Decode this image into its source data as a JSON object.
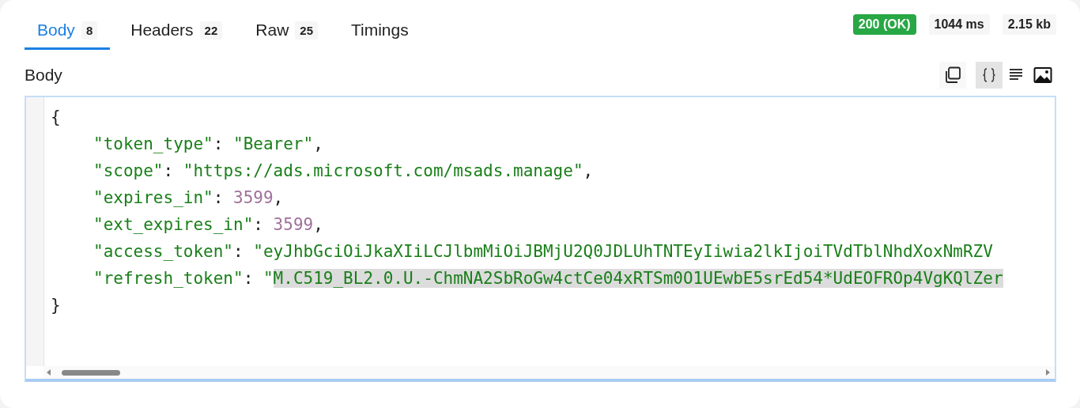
{
  "tabs": [
    {
      "label": "Body",
      "count": "8",
      "selected": true
    },
    {
      "label": "Headers",
      "count": "22",
      "selected": false
    },
    {
      "label": "Raw",
      "count": "25",
      "selected": false
    },
    {
      "label": "Timings",
      "selected": false
    }
  ],
  "status": {
    "code": "200 (OK)",
    "time": "1044 ms",
    "size": "2.15 kb"
  },
  "section_title": "Body",
  "view_modes": [
    {
      "kind": "json",
      "selected": true
    },
    {
      "kind": "text",
      "selected": false
    },
    {
      "kind": "image",
      "selected": false
    }
  ],
  "code_lines": [
    {
      "parts": [
        {
          "text": "{",
          "kind": "punct"
        }
      ]
    },
    {
      "parts": [
        {
          "text": "\"token_type\"",
          "kind": "key"
        },
        {
          "text": ": ",
          "kind": "punct"
        },
        {
          "text": "\"Bearer\"",
          "kind": "string"
        },
        {
          "text": ",",
          "kind": "punct"
        }
      ]
    },
    {
      "parts": [
        {
          "text": "\"scope\"",
          "kind": "key"
        },
        {
          "text": ": ",
          "kind": "punct"
        },
        {
          "text": "\"https://ads.microsoft.com/msads.manage\"",
          "kind": "string"
        },
        {
          "text": ",",
          "kind": "punct"
        }
      ]
    },
    {
      "parts": [
        {
          "text": "\"expires_in\"",
          "kind": "key"
        },
        {
          "text": ": ",
          "kind": "punct"
        },
        {
          "text": "3599",
          "kind": "number"
        },
        {
          "text": ",",
          "kind": "punct"
        }
      ]
    },
    {
      "parts": [
        {
          "text": "\"ext_expires_in\"",
          "kind": "key"
        },
        {
          "text": ": ",
          "kind": "punct"
        },
        {
          "text": "3599",
          "kind": "number"
        },
        {
          "text": ",",
          "kind": "punct"
        }
      ]
    },
    {
      "parts": [
        {
          "text": "\"access_token\"",
          "kind": "key"
        },
        {
          "text": ": ",
          "kind": "punct"
        },
        {
          "text": "\"eyJhbGciOiJkaXIiLCJlbmMiOiJBMjU2Q0JDLUhTNTEyIiwia2lkIjoiTVdTblNhdXoxNmRZV",
          "kind": "string"
        }
      ]
    },
    {
      "parts": [
        {
          "text": "\"refresh_token\"",
          "kind": "key"
        },
        {
          "text": ": ",
          "kind": "punct"
        },
        {
          "text": "\"",
          "kind": "string"
        },
        {
          "text": "M.C519_BL2.0.U.-ChmNA2SbRoGw4ctCe04xRTSm0O1UEwbE5srEd54*UdEOFROp4VgKQlZer",
          "kind": "string",
          "highlighted": true
        }
      ]
    },
    {
      "parts": [
        {
          "text": "}",
          "kind": "punct"
        }
      ]
    }
  ]
}
